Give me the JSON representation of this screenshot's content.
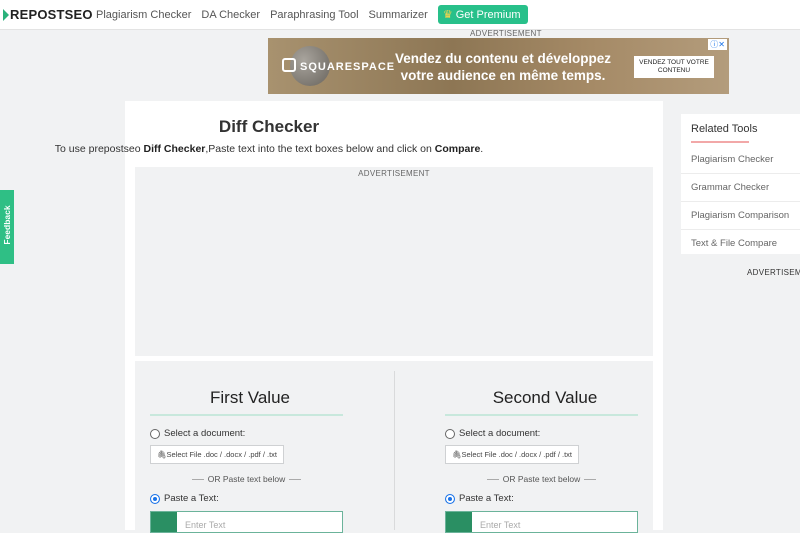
{
  "header": {
    "logo_text": "REPOSTSEO",
    "nav": [
      {
        "label": "Plagiarism Checker"
      },
      {
        "label": "DA Checker"
      },
      {
        "label": "Paraphrasing Tool"
      },
      {
        "label": "Summarizer"
      }
    ],
    "premium_label": "Get Premium"
  },
  "top_ad": {
    "label": "ADVERTISEMENT",
    "brand": "SQUARESPACE",
    "headline": "Vendez du contenu et développez votre audience en même temps.",
    "cta": "VENDEZ TOUT VOTRE CONTENU"
  },
  "main": {
    "title": "Diff Checker",
    "subtitle_pre": "To use prepostseo ",
    "subtitle_bold1": "Diff Checker",
    "subtitle_mid": ",Paste text into the text boxes below and click on ",
    "subtitle_bold2": "Compare",
    "subtitle_end": ".",
    "ad_label": "ADVERTISEMENT"
  },
  "columns": [
    {
      "title": "First Value",
      "select_doc_label": "Select a document:",
      "file_button": "Select File .doc / .docx / .pdf / .txt",
      "or_text": "OR Paste text below",
      "paste_label": "Paste a Text:",
      "placeholder": "Enter Text"
    },
    {
      "title": "Second Value",
      "select_doc_label": "Select a document:",
      "file_button": "Select File .doc / .docx / .pdf / .txt",
      "or_text": "OR Paste text below",
      "paste_label": "Paste a Text:",
      "placeholder": "Enter Text"
    }
  ],
  "sidebar": {
    "heading": "Related Tools",
    "items": [
      {
        "label": "Plagiarism Checker"
      },
      {
        "label": "Grammar Checker"
      },
      {
        "label": "Plagiarism Comparison"
      },
      {
        "label": "Text & File Compare"
      }
    ],
    "ad_label": "ADVERTISEMENT"
  },
  "feedback_label": "Feedback",
  "colors": {
    "accent_green": "#2fbf85",
    "premium_green": "#28c08a",
    "underline_pink": "#f2a8a8"
  }
}
